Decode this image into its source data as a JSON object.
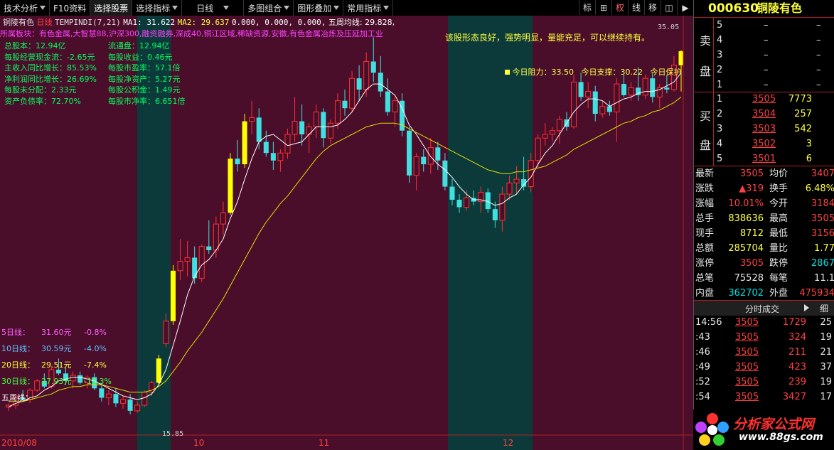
{
  "toolbar": {
    "items": [
      "技术分析",
      "F10资料",
      "选择股票",
      "选择指标",
      "日线",
      "多图组合",
      "图形叠加",
      "常用指标"
    ],
    "right_buttons": [
      "标",
      "⊞",
      "权",
      "线",
      "移",
      "◫",
      "▶"
    ]
  },
  "chart": {
    "stock_name": "铜陵有色",
    "period": "日线",
    "indicator": "TEMPINDI(7,21)",
    "ma1": "MA1: 31.622",
    "ma2": "MA2: 29.637",
    "extra": "0.000, 0.000, 0.000,",
    "weekly": "五周均线: 29.828,",
    "sector_label": "所属板块：",
    "sector": "有色金属,大智慧88,沪深300,融资融券,深成40,铜江区域,稀缺资源,安徽,有色金属冶炼及压延加工业",
    "comment": "该股形态良好，强势明显，量能充足，可以继续持有。",
    "resistance": "今日阻力：33.50",
    "support": "今日支撑：30.22",
    "protect": "今日保护",
    "high_label": "35.05",
    "low_label": "15.85",
    "fin": [
      "总股本：12.94亿",
      "流通盘：12.94亿",
      "每股经营现金流：-2.65元",
      "每股收益：0.46元",
      "主收入同比增长：85.53%",
      "每股市盈率：57.1倍",
      "净利润同比增长：26.69%",
      "每股净资产：5.27元",
      "每股未分配：2.33元",
      "每股公积金：1.49元",
      "资产负债率：72.70%",
      "每股市净率：6.651倍"
    ],
    "ma_legend": [
      {
        "name": "5日线：",
        "price": "31.60元",
        "pct": "-0.8%",
        "color": "#ff60ff"
      },
      {
        "name": "10日线：",
        "price": "30.59元",
        "pct": "-4.0%",
        "color": "#60c0ff"
      },
      {
        "name": "20日线：",
        "price": "29.51元",
        "pct": "-7.4%",
        "color": "#ffff40"
      },
      {
        "name": "30日线：",
        "price": "27.93元",
        "pct": "-12.3%",
        "color": "#40ff40"
      },
      {
        "name": "五周线：",
        "price": "",
        "pct": "",
        "color": "#ffffff"
      }
    ],
    "dates": [
      "2010/08",
      "10",
      "11",
      "12"
    ]
  },
  "chart_data": {
    "type": "candlestick",
    "ylim": [
      14.5,
      36.5
    ],
    "candles": [
      [
        16.0,
        16.2,
        15.8,
        16.1
      ],
      [
        16.1,
        16.6,
        15.9,
        16.5
      ],
      [
        16.5,
        16.9,
        16.3,
        16.4
      ],
      [
        16.4,
        17.0,
        16.2,
        16.9
      ],
      [
        16.9,
        17.5,
        16.8,
        17.4
      ],
      [
        17.4,
        17.8,
        17.0,
        17.1
      ],
      [
        17.1,
        18.2,
        17.0,
        18.0
      ],
      [
        18.0,
        18.6,
        17.7,
        17.8
      ],
      [
        17.8,
        18.1,
        17.2,
        17.4
      ],
      [
        17.4,
        17.9,
        17.0,
        17.7
      ],
      [
        17.7,
        17.9,
        17.2,
        17.3
      ],
      [
        17.3,
        17.7,
        17.0,
        17.6
      ],
      [
        17.6,
        17.8,
        16.9,
        17.0
      ],
      [
        17.0,
        17.3,
        16.3,
        16.5
      ],
      [
        16.5,
        16.9,
        16.1,
        16.7
      ],
      [
        16.7,
        17.0,
        16.0,
        16.2
      ],
      [
        16.2,
        16.6,
        15.9,
        16.4
      ],
      [
        16.4,
        16.7,
        15.6,
        15.8
      ],
      [
        15.8,
        16.3,
        15.7,
        16.1
      ],
      [
        16.1,
        16.9,
        16.0,
        16.8
      ],
      [
        16.8,
        17.4,
        16.6,
        17.3
      ],
      [
        17.3,
        18.8,
        17.2,
        18.6
      ],
      [
        19.4,
        21.0,
        19.2,
        20.6
      ],
      [
        20.6,
        23.6,
        20.4,
        23.3
      ],
      [
        23.3,
        25.0,
        22.8,
        23.8
      ],
      [
        23.8,
        24.9,
        23.0,
        24.0
      ],
      [
        24.0,
        24.6,
        22.6,
        22.9
      ],
      [
        22.9,
        24.7,
        22.7,
        24.6
      ],
      [
        24.6,
        26.0,
        24.2,
        24.4
      ],
      [
        24.4,
        26.2,
        24.0,
        25.8
      ],
      [
        25.8,
        27.0,
        25.2,
        26.4
      ],
      [
        26.4,
        29.6,
        26.3,
        29.3
      ],
      [
        29.3,
        30.3,
        28.6,
        29.0
      ],
      [
        29.0,
        31.7,
        28.8,
        31.3
      ],
      [
        31.3,
        32.4,
        30.6,
        31.5
      ],
      [
        31.5,
        32.0,
        29.8,
        30.2
      ],
      [
        30.2,
        30.8,
        29.4,
        29.6
      ],
      [
        29.6,
        30.2,
        28.7,
        29.2
      ],
      [
        29.2,
        29.8,
        28.6,
        29.6
      ],
      [
        29.6,
        30.9,
        29.3,
        30.6
      ],
      [
        30.6,
        32.6,
        30.2,
        31.3
      ],
      [
        31.3,
        32.2,
        30.0,
        30.6
      ],
      [
        30.6,
        31.2,
        29.6,
        31.0
      ],
      [
        31.0,
        32.2,
        30.4,
        31.8
      ],
      [
        31.8,
        32.0,
        29.9,
        30.4
      ],
      [
        30.4,
        31.4,
        30.1,
        31.2
      ],
      [
        31.2,
        32.8,
        30.9,
        32.4
      ],
      [
        32.4,
        33.0,
        31.6,
        32.0
      ],
      [
        32.0,
        34.0,
        31.8,
        33.6
      ],
      [
        33.6,
        34.3,
        32.4,
        33.0
      ],
      [
        33.0,
        35.0,
        32.6,
        34.5
      ],
      [
        34.5,
        35.8,
        33.4,
        33.9
      ],
      [
        33.9,
        34.8,
        32.6,
        32.9
      ],
      [
        32.9,
        33.6,
        31.6,
        31.8
      ],
      [
        31.8,
        32.6,
        31.0,
        32.4
      ],
      [
        32.4,
        32.8,
        30.5,
        30.8
      ],
      [
        30.8,
        31.0,
        28.0,
        28.4
      ],
      [
        28.4,
        29.6,
        27.6,
        29.4
      ],
      [
        29.4,
        29.8,
        28.6,
        29.0
      ],
      [
        29.0,
        30.4,
        28.5,
        29.9
      ],
      [
        29.9,
        30.2,
        28.7,
        29.2
      ],
      [
        29.2,
        29.6,
        27.6,
        27.8
      ],
      [
        27.8,
        28.2,
        26.8,
        27.1
      ],
      [
        27.1,
        27.4,
        26.4,
        26.7
      ],
      [
        26.7,
        27.6,
        26.5,
        27.2
      ],
      [
        27.2,
        27.6,
        26.8,
        27.0
      ],
      [
        27.0,
        27.8,
        26.4,
        27.5
      ],
      [
        27.5,
        27.7,
        26.4,
        26.6
      ],
      [
        26.6,
        27.0,
        25.6,
        26.0
      ],
      [
        26.0,
        27.8,
        25.4,
        27.4
      ],
      [
        27.4,
        28.4,
        27.1,
        28.0
      ],
      [
        28.0,
        28.9,
        27.4,
        28.2
      ],
      [
        28.2,
        29.4,
        27.6,
        27.8
      ],
      [
        27.8,
        29.6,
        27.5,
        29.2
      ],
      [
        29.2,
        30.6,
        28.8,
        30.4
      ],
      [
        30.4,
        31.2,
        30.0,
        30.6
      ],
      [
        30.6,
        31.0,
        30.2,
        30.8
      ],
      [
        30.8,
        31.6,
        30.1,
        31.4
      ],
      [
        31.4,
        31.8,
        30.8,
        31.0
      ],
      [
        31.0,
        33.8,
        30.9,
        33.4
      ],
      [
        33.4,
        33.9,
        32.4,
        32.6
      ],
      [
        32.6,
        33.4,
        32.0,
        32.9
      ],
      [
        32.9,
        33.2,
        31.3,
        31.7
      ],
      [
        31.7,
        32.4,
        31.5,
        32.1
      ],
      [
        32.1,
        32.4,
        31.6,
        31.8
      ],
      [
        31.8,
        33.6,
        30.2,
        33.3
      ],
      [
        33.3,
        33.8,
        32.6,
        32.7
      ],
      [
        32.7,
        33.4,
        32.4,
        33.1
      ],
      [
        33.1,
        34.2,
        32.4,
        32.7
      ],
      [
        32.7,
        33.8,
        32.5,
        33.6
      ],
      [
        33.6,
        33.9,
        32.3,
        32.6
      ],
      [
        32.6,
        33.3,
        32.0,
        33.1
      ],
      [
        33.1,
        33.8,
        32.8,
        33.0
      ],
      [
        33.0,
        34.8,
        32.9,
        34.3
      ],
      [
        34.3,
        35.1,
        32.9,
        35.05
      ]
    ],
    "limit_up_indices": [
      21,
      23,
      31,
      33,
      94
    ],
    "ma5": [
      16.0,
      16.2,
      16.3,
      16.5,
      16.6,
      16.9,
      17.1,
      17.4,
      17.5,
      17.6,
      17.6,
      17.5,
      17.4,
      17.2,
      17.0,
      16.8,
      16.6,
      16.5,
      16.4,
      16.5,
      16.7,
      17.2,
      18.0,
      19.3,
      20.6,
      22.0,
      23.0,
      23.6,
      23.9,
      24.4,
      25.0,
      26.1,
      27.0,
      28.2,
      29.3,
      30.2,
      30.5,
      30.6,
      30.3,
      30.0,
      30.1,
      30.2,
      30.6,
      31.0,
      31.0,
      31.0,
      31.1,
      31.4,
      31.8,
      32.4,
      33.0,
      33.3,
      33.3,
      33.0,
      32.7,
      32.0,
      31.1,
      30.6,
      30.0,
      29.4,
      29.0,
      28.7,
      28.3,
      27.8,
      27.4,
      27.1,
      27.1,
      27.0,
      26.8,
      26.9,
      27.2,
      27.4,
      27.9,
      28.3,
      29.0,
      29.6,
      30.0,
      30.6,
      31.2,
      31.8,
      32.2,
      32.5,
      32.5,
      32.4,
      32.1,
      32.3,
      32.5,
      32.6,
      32.8,
      32.9,
      32.9,
      33.0,
      33.2,
      33.4,
      33.9
    ],
    "ma20": [
      16.3,
      16.3,
      16.3,
      16.4,
      16.5,
      16.6,
      16.7,
      16.9,
      17.0,
      17.1,
      17.1,
      17.2,
      17.2,
      17.2,
      17.1,
      17.0,
      16.9,
      16.8,
      16.8,
      16.8,
      16.9,
      17.1,
      17.4,
      17.9,
      18.4,
      19.0,
      19.5,
      20.0,
      20.6,
      21.2,
      21.8,
      22.5,
      23.2,
      23.9,
      24.6,
      25.3,
      25.9,
      26.4,
      26.9,
      27.3,
      27.8,
      28.3,
      28.8,
      29.3,
      29.7,
      30.0,
      30.2,
      30.4,
      30.6,
      30.8,
      31.0,
      31.1,
      31.2,
      31.2,
      31.2,
      31.1,
      30.9,
      30.7,
      30.5,
      30.3,
      30.1,
      29.9,
      29.7,
      29.5,
      29.3,
      29.1,
      28.9,
      28.7,
      28.6,
      28.5,
      28.5,
      28.6,
      28.6,
      28.7,
      28.8,
      28.9,
      29.1,
      29.3,
      29.5,
      29.8,
      30.0,
      30.2,
      30.4,
      30.6,
      30.8,
      31.0,
      31.2,
      31.3,
      31.5,
      31.6,
      31.8,
      31.9,
      32.1,
      32.3,
      32.6
    ]
  },
  "panel": {
    "code": "000630",
    "name": "铜陵有色",
    "sell_label": [
      "卖",
      "盘"
    ],
    "buy_label": [
      "买",
      "盘"
    ],
    "sell": [
      {
        "lvl": "5",
        "price": "–",
        "vol": "–"
      },
      {
        "lvl": "4",
        "price": "–",
        "vol": "–"
      },
      {
        "lvl": "3",
        "price": "–",
        "vol": "–"
      },
      {
        "lvl": "2",
        "price": "–",
        "vol": "–"
      },
      {
        "lvl": "1",
        "price": "–",
        "vol": "–"
      }
    ],
    "buy": [
      {
        "lvl": "1",
        "price": "3505",
        "vol": "7773"
      },
      {
        "lvl": "2",
        "price": "3504",
        "vol": "257"
      },
      {
        "lvl": "3",
        "price": "3503",
        "vol": "542"
      },
      {
        "lvl": "4",
        "price": "3502",
        "vol": "3"
      },
      {
        "lvl": "5",
        "price": "3501",
        "vol": "6"
      }
    ],
    "stats": [
      {
        "l1": "最新",
        "v1": "3505",
        "c1": "red",
        "l2": "均价",
        "v2": "3407",
        "c2": "red"
      },
      {
        "l1": "涨跌",
        "v1": "▲319",
        "c1": "red",
        "l2": "换手",
        "v2": "6.48%",
        "c2": "yellow"
      },
      {
        "l1": "涨幅",
        "v1": "10.01%",
        "c1": "red",
        "l2": "今开",
        "v2": "3184",
        "c2": "red"
      },
      {
        "l1": "总手",
        "v1": "838636",
        "c1": "yellow",
        "l2": "最高",
        "v2": "3505",
        "c2": "red"
      },
      {
        "l1": "现手",
        "v1": "8712",
        "c1": "yellow",
        "l2": "最低",
        "v2": "3156",
        "c2": "red"
      },
      {
        "l1": "总额",
        "v1": "285704",
        "c1": "yellow",
        "l2": "量比",
        "v2": "1.77",
        "c2": "yellow"
      },
      {
        "l1": "涨停",
        "v1": "3505",
        "c1": "red",
        "l2": "跌停",
        "v2": "2867",
        "c2": "green"
      },
      {
        "l1": "总笔",
        "v1": "75528",
        "c1": "white",
        "l2": "每笔",
        "v2": "11.1",
        "c2": "white"
      },
      {
        "l1": "内盘",
        "v1": "362702",
        "c1": "green",
        "l2": "外盘",
        "v2": "475934",
        "c2": "red"
      }
    ],
    "ticks_header": "分时成交",
    "ticks_btn": "细",
    "ticks": [
      {
        "t": "14:56",
        "p": "3505",
        "v": "1729",
        "n": "25"
      },
      {
        "t": ":43",
        "p": "3505",
        "v": "324",
        "n": "19"
      },
      {
        "t": ":46",
        "p": "3505",
        "v": "211",
        "n": "21"
      },
      {
        "t": ":49",
        "p": "3505",
        "v": "423",
        "n": "37"
      },
      {
        "t": ":52",
        "p": "3505",
        "v": "239",
        "n": "19"
      },
      {
        "t": ":54",
        "p": "3505",
        "v": "3427",
        "n": "17"
      }
    ],
    "watermark": "分析家公式网",
    "watermark_url": "www.88gs.com"
  }
}
